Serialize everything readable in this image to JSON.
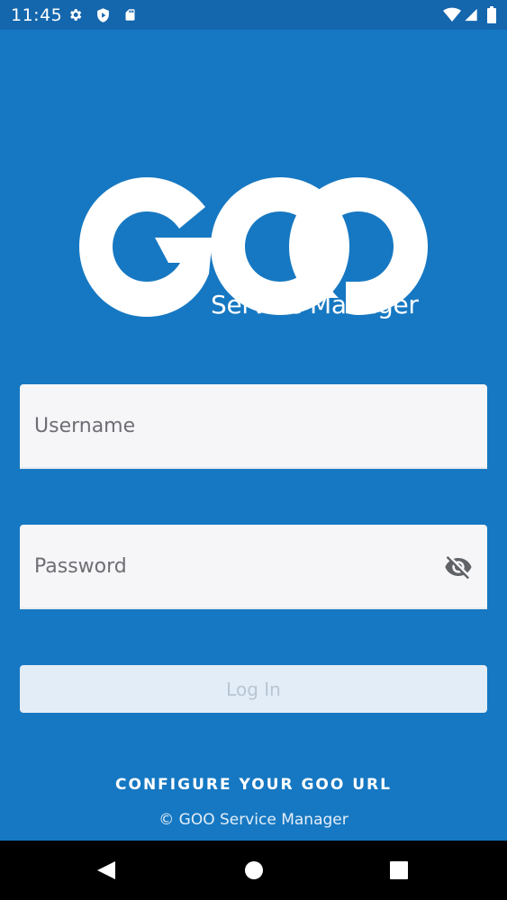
{
  "status_bar": {
    "time": "11:45",
    "icons": [
      "gear-icon",
      "play-protect-icon",
      "sd-card-icon",
      "wifi-icon",
      "signal-icon",
      "battery-icon"
    ]
  },
  "logo": {
    "brand": "GOO",
    "subtitle": "Service Manager"
  },
  "form": {
    "username_placeholder": "Username",
    "password_placeholder": "Password",
    "login_label": "Log In"
  },
  "footer": {
    "configure_label": "CONFIGURE YOUR GOO URL",
    "copyright": "© GOO Service Manager"
  },
  "colors": {
    "background": "#1678c2",
    "status_bar": "#1466ad",
    "field": "#f6f5f8",
    "button_disabled": "#e3edf7"
  }
}
